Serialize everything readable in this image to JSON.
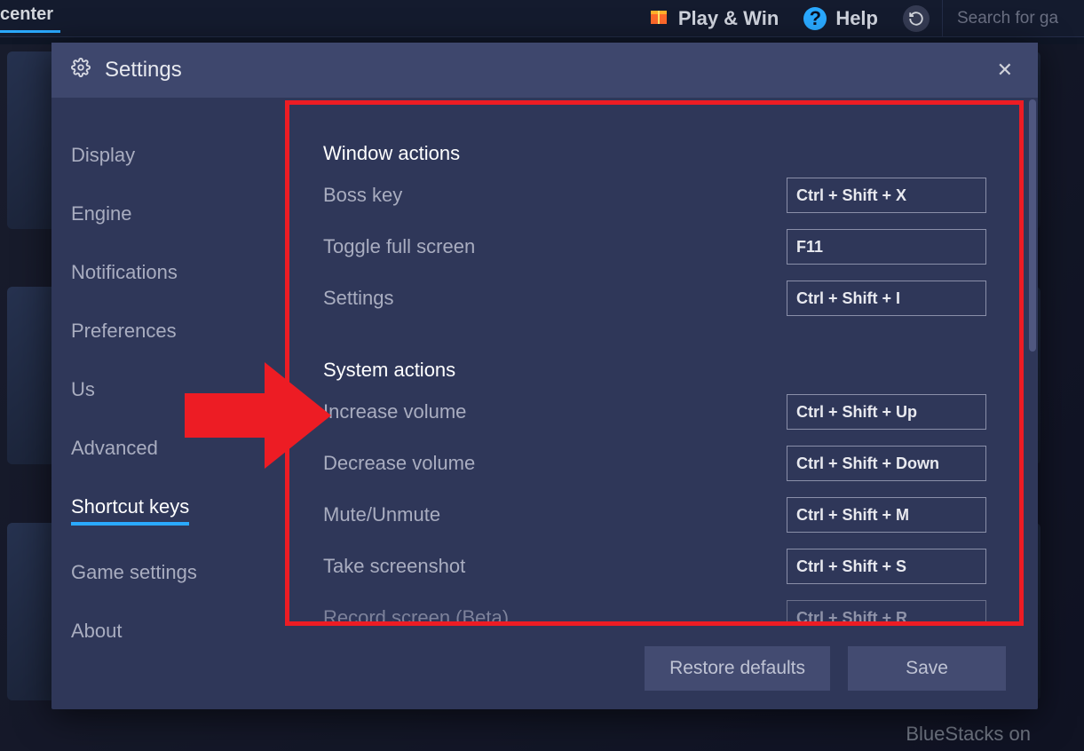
{
  "topbar": {
    "center_tab": "center",
    "play_win": "Play & Win",
    "help": "Help",
    "search_placeholder": "Search for ga"
  },
  "bg": {
    "btm_label": "BlueStacks on"
  },
  "modal": {
    "title": "Settings",
    "close": "✕"
  },
  "sidebar": {
    "items": [
      {
        "label": "Display"
      },
      {
        "label": "Engine"
      },
      {
        "label": "Notifications"
      },
      {
        "label": "Preferences"
      },
      {
        "label": "Us"
      },
      {
        "label": "Advanced"
      },
      {
        "label": "Shortcut keys"
      },
      {
        "label": "Game settings"
      },
      {
        "label": "About"
      }
    ]
  },
  "content": {
    "section1_title": "Window actions",
    "section2_title": "System actions",
    "rows1": [
      {
        "label": "Boss key",
        "value": "Ctrl + Shift + X"
      },
      {
        "label": "Toggle full screen",
        "value": "F11"
      },
      {
        "label": "Settings",
        "value": "Ctrl + Shift + I"
      }
    ],
    "rows2": [
      {
        "label": "Increase volume",
        "value": "Ctrl + Shift + Up"
      },
      {
        "label": "Decrease volume",
        "value": "Ctrl + Shift + Down"
      },
      {
        "label": "Mute/Unmute",
        "value": "Ctrl + Shift + M"
      },
      {
        "label": "Take screenshot",
        "value": "Ctrl + Shift + S"
      },
      {
        "label": "Record screen (Beta)",
        "value": "Ctrl + Shift + R"
      }
    ]
  },
  "footer": {
    "restore": "Restore defaults",
    "save": "Save"
  }
}
